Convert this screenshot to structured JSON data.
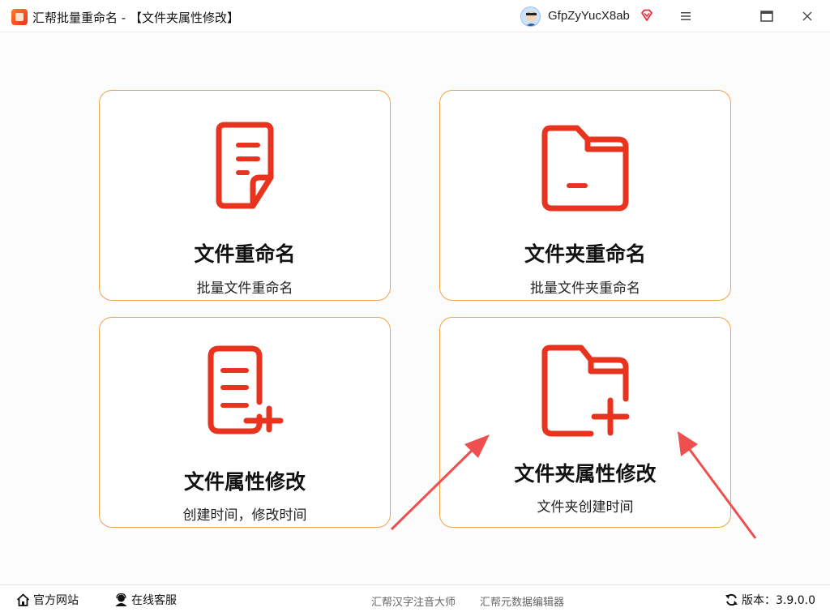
{
  "window": {
    "title": "汇帮批量重命名 - 【文件夹属性修改】",
    "username": "GfpZyYucX8ab"
  },
  "cards": [
    {
      "title": "文件重命名",
      "subtitle": "批量文件重命名",
      "icon": "document-icon"
    },
    {
      "title": "文件夹重命名",
      "subtitle": "批量文件夹重命名",
      "icon": "folder-icon"
    },
    {
      "title": "文件属性修改",
      "subtitle": "创建时间，修改时间",
      "icon": "document-plus-icon"
    },
    {
      "title": "文件夹属性修改",
      "subtitle": "文件夹创建时间",
      "icon": "folder-plus-icon"
    }
  ],
  "statusbar": {
    "home": "官方网站",
    "service": "在线客服",
    "link_hanzi": "汇帮汉字注音大师",
    "link_meta": "汇帮元数据编辑器",
    "version": "版本：3.9.0.0"
  },
  "colors": {
    "accent": "#e8341f",
    "card_border": "#f0a348",
    "annotation_arrow": "#f04f4f"
  }
}
